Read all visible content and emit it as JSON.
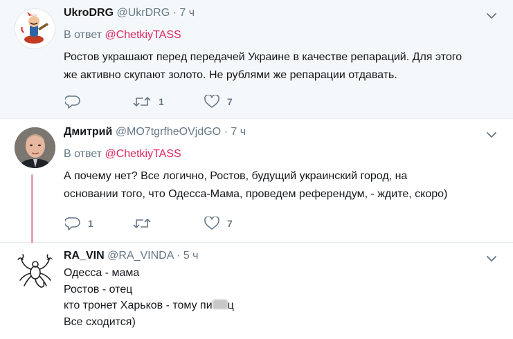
{
  "tweets": [
    {
      "name": "UkroDRG",
      "handle": "@UkrDRG",
      "time": "7 ч",
      "reply_prefix": "В ответ",
      "reply_to": "@ChetkiyTASS",
      "lines": [
        "Ростов украшают перед передачей Украине в качестве репараций. Для этого",
        "же активно скупают золото. Не рублями же репарации отдавать."
      ],
      "replies": "",
      "retweets": "1",
      "likes": "7"
    },
    {
      "name": "Дмитрий",
      "handle": "@MO7tgrfheOVjdGO",
      "time": "7 ч",
      "reply_prefix": "В ответ",
      "reply_to": "@ChetkiyTASS",
      "lines": [
        "А почему нет? Все логично, Ростов, будущий украинский город, на",
        "основании того, что Одесса-Мама, проведем референдум, - ждите, скоро)"
      ],
      "replies": "1",
      "retweets": "",
      "likes": "7"
    },
    {
      "name": "RA_VIN",
      "handle": "@RA_VINDA",
      "time": "5 ч",
      "lines": [
        "Одесса - мама",
        "Ростов - отец",
        "кто тронет Харьков - тому пи",
        "Все сходится)"
      ],
      "line3_suffix": "ц"
    }
  ],
  "separator": "·",
  "colors": {
    "mention": "#e0245e",
    "muted": "#657786",
    "highlight_bg": "#f5f8fa",
    "thread_line": "#e5a6b0"
  },
  "icons": [
    "chevron-down-icon",
    "reply-icon",
    "retweet-icon",
    "like-icon"
  ]
}
